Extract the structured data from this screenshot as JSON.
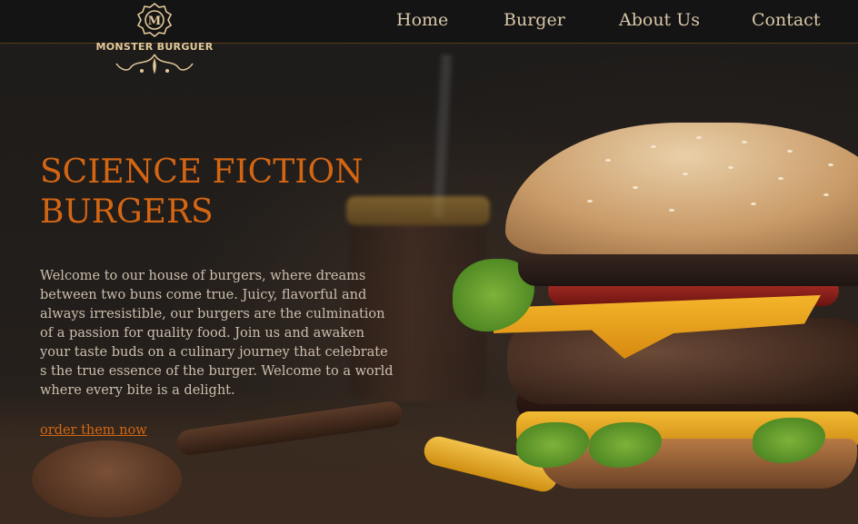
{
  "brand": {
    "name": "MONSTER BURGUER",
    "emblem_letter": "M"
  },
  "nav": {
    "items": [
      {
        "label": "Home"
      },
      {
        "label": "Burger"
      },
      {
        "label": "About Us"
      },
      {
        "label": "Contact"
      }
    ]
  },
  "hero": {
    "title_line1": "SCIENCE FICTION",
    "title_line2": "BURGERS",
    "paragraph": "Welcome to our house of burgers, where dreams between two buns come true. Juicy, flavorful and always irresistible, our burgers are the culmination of a passion for quality food. Join us and awaken your taste buds on a culinary journey that celebrate s the true essence of the burger. Welcome to a world where every bite is a delight.",
    "cta_label": "order them now"
  },
  "colors": {
    "accent": "#d46613",
    "nav_text": "#d9c6a8",
    "body_text": "#cdbfae",
    "header_bg": "#141414",
    "logo_gold": "#e3c99a"
  },
  "images": {
    "hero_background": "burger-photo"
  }
}
